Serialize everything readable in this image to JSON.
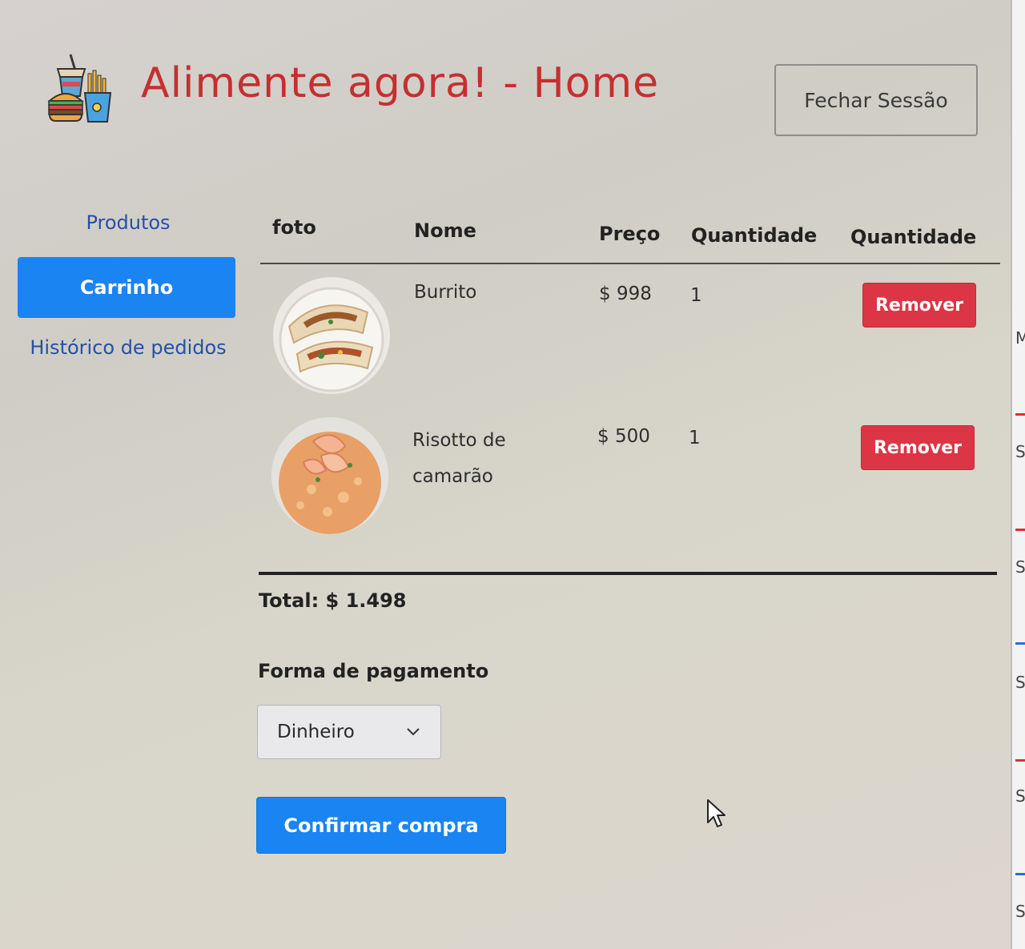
{
  "header": {
    "title": "Alimente agora! - Home",
    "logout_label": "Fechar Sessão",
    "logo_icon": "fast-food-icon"
  },
  "sidebar": {
    "items": [
      {
        "label": "Produtos",
        "active": false
      },
      {
        "label": "Carrinho",
        "active": true
      },
      {
        "label": "Histórico de pedidos",
        "active": false
      }
    ]
  },
  "cart_table": {
    "headers": [
      "foto",
      "Nome",
      "Preço",
      "Quantidade",
      "Quantidade"
    ],
    "rows": [
      {
        "image": "burrito-photo",
        "name": "Burrito",
        "price": "$ 998",
        "quantity": "1",
        "action": "Remover"
      },
      {
        "image": "shrimp-risotto-photo",
        "name": "Risotto de camarão",
        "price": "$ 500",
        "quantity": "1",
        "action": "Remover"
      }
    ],
    "total": "Total: $ 1.498"
  },
  "payment": {
    "label": "Forma de pagamento",
    "selected": "Dinheiro",
    "confirm_label": "Confirmar compra"
  },
  "colors": {
    "primary": "#1a84f2",
    "danger": "#dc3545",
    "title": "#c62f2f",
    "nav_link": "#2550a8"
  },
  "edge_strip": {
    "letters": [
      "M",
      "S",
      "S",
      "S",
      "S",
      "S"
    ]
  }
}
